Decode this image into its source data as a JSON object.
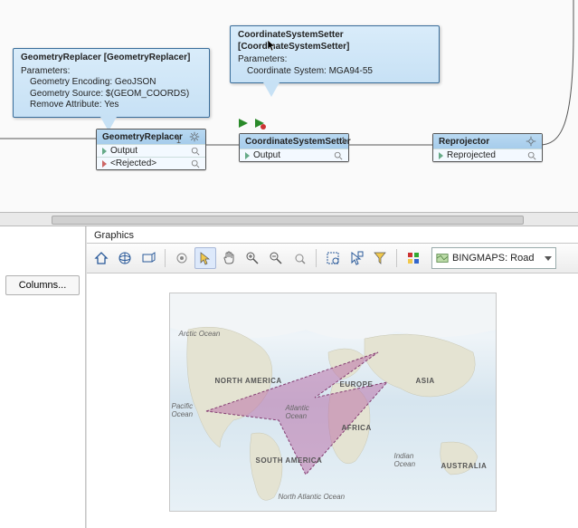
{
  "canvas": {
    "tooltip1": {
      "title": "GeometryReplacer [GeometryReplacer]",
      "param_header": "Parameters:",
      "p1": "Geometry Encoding: GeoJSON",
      "p2": "Geometry Source: $(GEOM_COORDS)",
      "p3": "Remove Attribute: Yes"
    },
    "tooltip2": {
      "title": "CoordinateSystemSetter [CoordinateSystemSetter]",
      "param_header": "Parameters:",
      "p1": "Coordinate System: MGA94-55"
    },
    "node1": {
      "title": "GeometryReplacer",
      "port1": "Output",
      "port2": "<Rejected>"
    },
    "node2": {
      "title": "CoordinateSystemSetter",
      "port1": "Output"
    },
    "node3": {
      "title": "Reprojector",
      "port1": "Reprojected"
    },
    "conn12": "1",
    "conn23": "1"
  },
  "lower": {
    "columns_btn": "Columns...",
    "graphics_label": "Graphics",
    "basemap": "BINGMAPS: Road"
  },
  "map_labels": {
    "arctic": "Arctic Ocean",
    "na": "NORTH AMERICA",
    "sa": "SOUTH AMERICA",
    "eu": "EUROPE",
    "af": "AFRICA",
    "as": "ASIA",
    "au": "AUSTRALIA",
    "pac": "Pacific Ocean",
    "atl": "Atlantic Ocean",
    "ind": "Indian Ocean",
    "natl": "North Atlantic Ocean"
  },
  "chart_data": {
    "type": "map",
    "projection": "equirectangular",
    "basemap": "BINGMAPS: Road",
    "continents": [
      "North America",
      "South America",
      "Europe",
      "Africa",
      "Asia",
      "Australia"
    ],
    "overlay": {
      "description": "Arrow/chevron polygon (corrupted reprojected geometry) spanning roughly between North America and Europe/Africa pointing west, shaded semi-transparent pink/purple.",
      "fill": "#b768a3",
      "opacity": 0.5
    }
  }
}
